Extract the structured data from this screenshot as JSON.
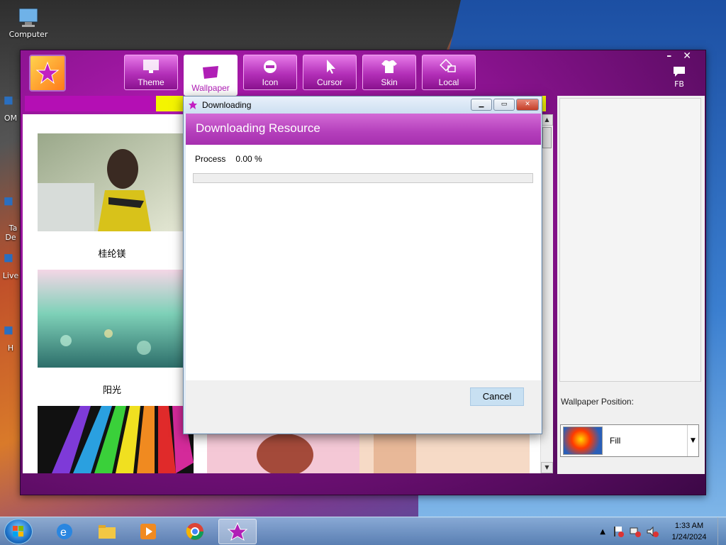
{
  "desktop": {
    "icons": [
      {
        "label": "Computer"
      },
      {
        "label": "OM"
      },
      {
        "label": "Ta\nDe"
      },
      {
        "label": "Live"
      },
      {
        "label": "H"
      }
    ]
  },
  "app": {
    "tabs": [
      {
        "label": "Theme",
        "icon": "monitor-icon"
      },
      {
        "label": "Wallpaper",
        "icon": "wallpaper-icon",
        "active": true
      },
      {
        "label": "Icon",
        "icon": "icon-icon"
      },
      {
        "label": "Cursor",
        "icon": "cursor-icon"
      },
      {
        "label": "Skin",
        "icon": "shirt-icon"
      },
      {
        "label": "Local",
        "icon": "local-icon"
      }
    ],
    "minimize_label": "–",
    "close_label": "✕",
    "fb_label": "FB",
    "wallpapers": [
      {
        "caption": "桂纶镁"
      },
      {
        "caption": "阳光"
      }
    ],
    "right_panel": {
      "position_label": "Wallpaper Position:",
      "position_value": "Fill"
    }
  },
  "dialog": {
    "title": "Downloading",
    "header": "Downloading Resource",
    "process_label": "Process",
    "process_value": "0.00 %",
    "progress": 0.0,
    "cancel_label": "Cancel"
  },
  "taskbar": {
    "time": "1:33 AM",
    "date": "1/24/2024",
    "apps": [
      "internet-explorer-icon",
      "file-explorer-icon",
      "media-player-icon",
      "chrome-icon",
      "theme-app-icon"
    ]
  },
  "colors": {
    "accent_magenta": "#b01fb6",
    "progress_strip": "#b40fb4",
    "yellow_strip": "#f4f400"
  }
}
